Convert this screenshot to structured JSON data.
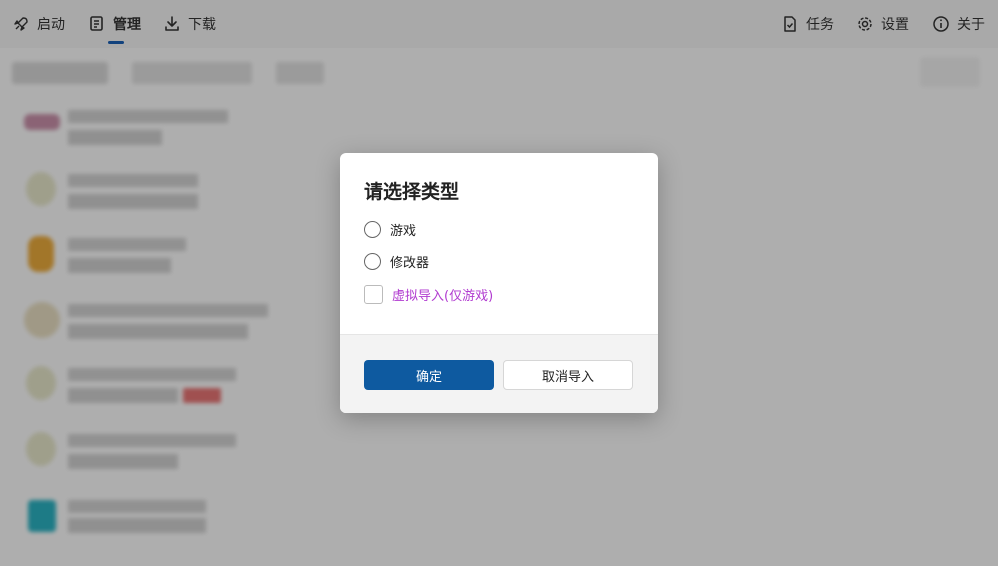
{
  "nav": {
    "launch": "启动",
    "manage": "管理",
    "download": "下载",
    "tasks": "任务",
    "settings": "设置",
    "about": "关于"
  },
  "dialog": {
    "title": "请选择类型",
    "options": [
      {
        "label": "游戏",
        "selected": false
      },
      {
        "label": "修改器",
        "selected": false
      }
    ],
    "virtual_import": {
      "label": "虚拟导入(仅游戏)",
      "checked": false
    },
    "confirm": "确定",
    "cancel": "取消导入"
  },
  "colors": {
    "accent": "#0e5aa0",
    "virtual_label": "#b13bd0",
    "overlay": "rgba(0,0,0,0.30)"
  }
}
